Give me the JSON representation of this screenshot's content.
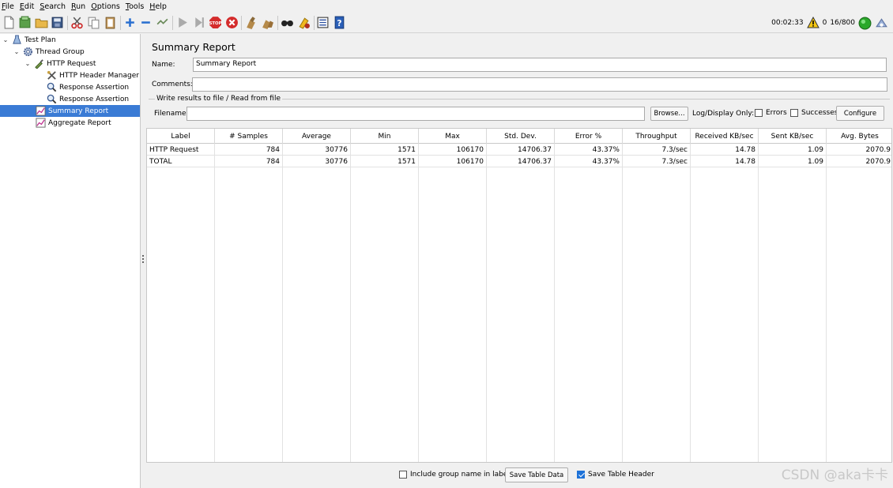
{
  "menubar": [
    {
      "first": "F",
      "rest": "ile"
    },
    {
      "first": "E",
      "rest": "dit"
    },
    {
      "first": "S",
      "rest": "earch"
    },
    {
      "first": "R",
      "rest": "un"
    },
    {
      "first": "O",
      "rest": "ptions"
    },
    {
      "first": "T",
      "rest": "ools"
    },
    {
      "first": "H",
      "rest": "elp"
    }
  ],
  "status": {
    "elapsed": "00:02:33",
    "warnings": "0",
    "threads": "16/800"
  },
  "tree": {
    "test_plan": "Test Plan",
    "thread_group": "Thread Group",
    "http_request": "HTTP Request",
    "header_manager": "HTTP Header Manager",
    "assertion_1": "Response Assertion",
    "assertion_2": "Response Assertion",
    "summary_report": "Summary Report",
    "aggregate_report": "Aggregate Report"
  },
  "panel": {
    "title": "Summary Report",
    "name_label": "Name:",
    "name_value": "Summary Report",
    "comments_label": "Comments:",
    "comments_value": "",
    "file_section": "Write results to file / Read from file",
    "filename_label": "Filename",
    "filename_value": "",
    "browse": "Browse...",
    "log_display": "Log/Display Only:",
    "errors": "Errors",
    "successes": "Successes",
    "configure": "Configure"
  },
  "table": {
    "headers": [
      "Label",
      "# Samples",
      "Average",
      "Min",
      "Max",
      "Std. Dev.",
      "Error %",
      "Throughput",
      "Received KB/sec",
      "Sent KB/sec",
      "Avg. Bytes"
    ],
    "rows": [
      [
        "HTTP Request",
        "784",
        "30776",
        "1571",
        "106170",
        "14706.37",
        "43.37%",
        "7.3/sec",
        "14.78",
        "1.09",
        "2070.9"
      ],
      [
        "TOTAL",
        "784",
        "30776",
        "1571",
        "106170",
        "14706.37",
        "43.37%",
        "7.3/sec",
        "14.78",
        "1.09",
        "2070.9"
      ]
    ]
  },
  "footer": {
    "include_group": "Include group name in label?",
    "include_group_checked": false,
    "save_table_data": "Save Table Data",
    "save_table_header": "Save Table Header",
    "save_table_header_checked": true
  },
  "watermark": "CSDN @aka卡卡"
}
